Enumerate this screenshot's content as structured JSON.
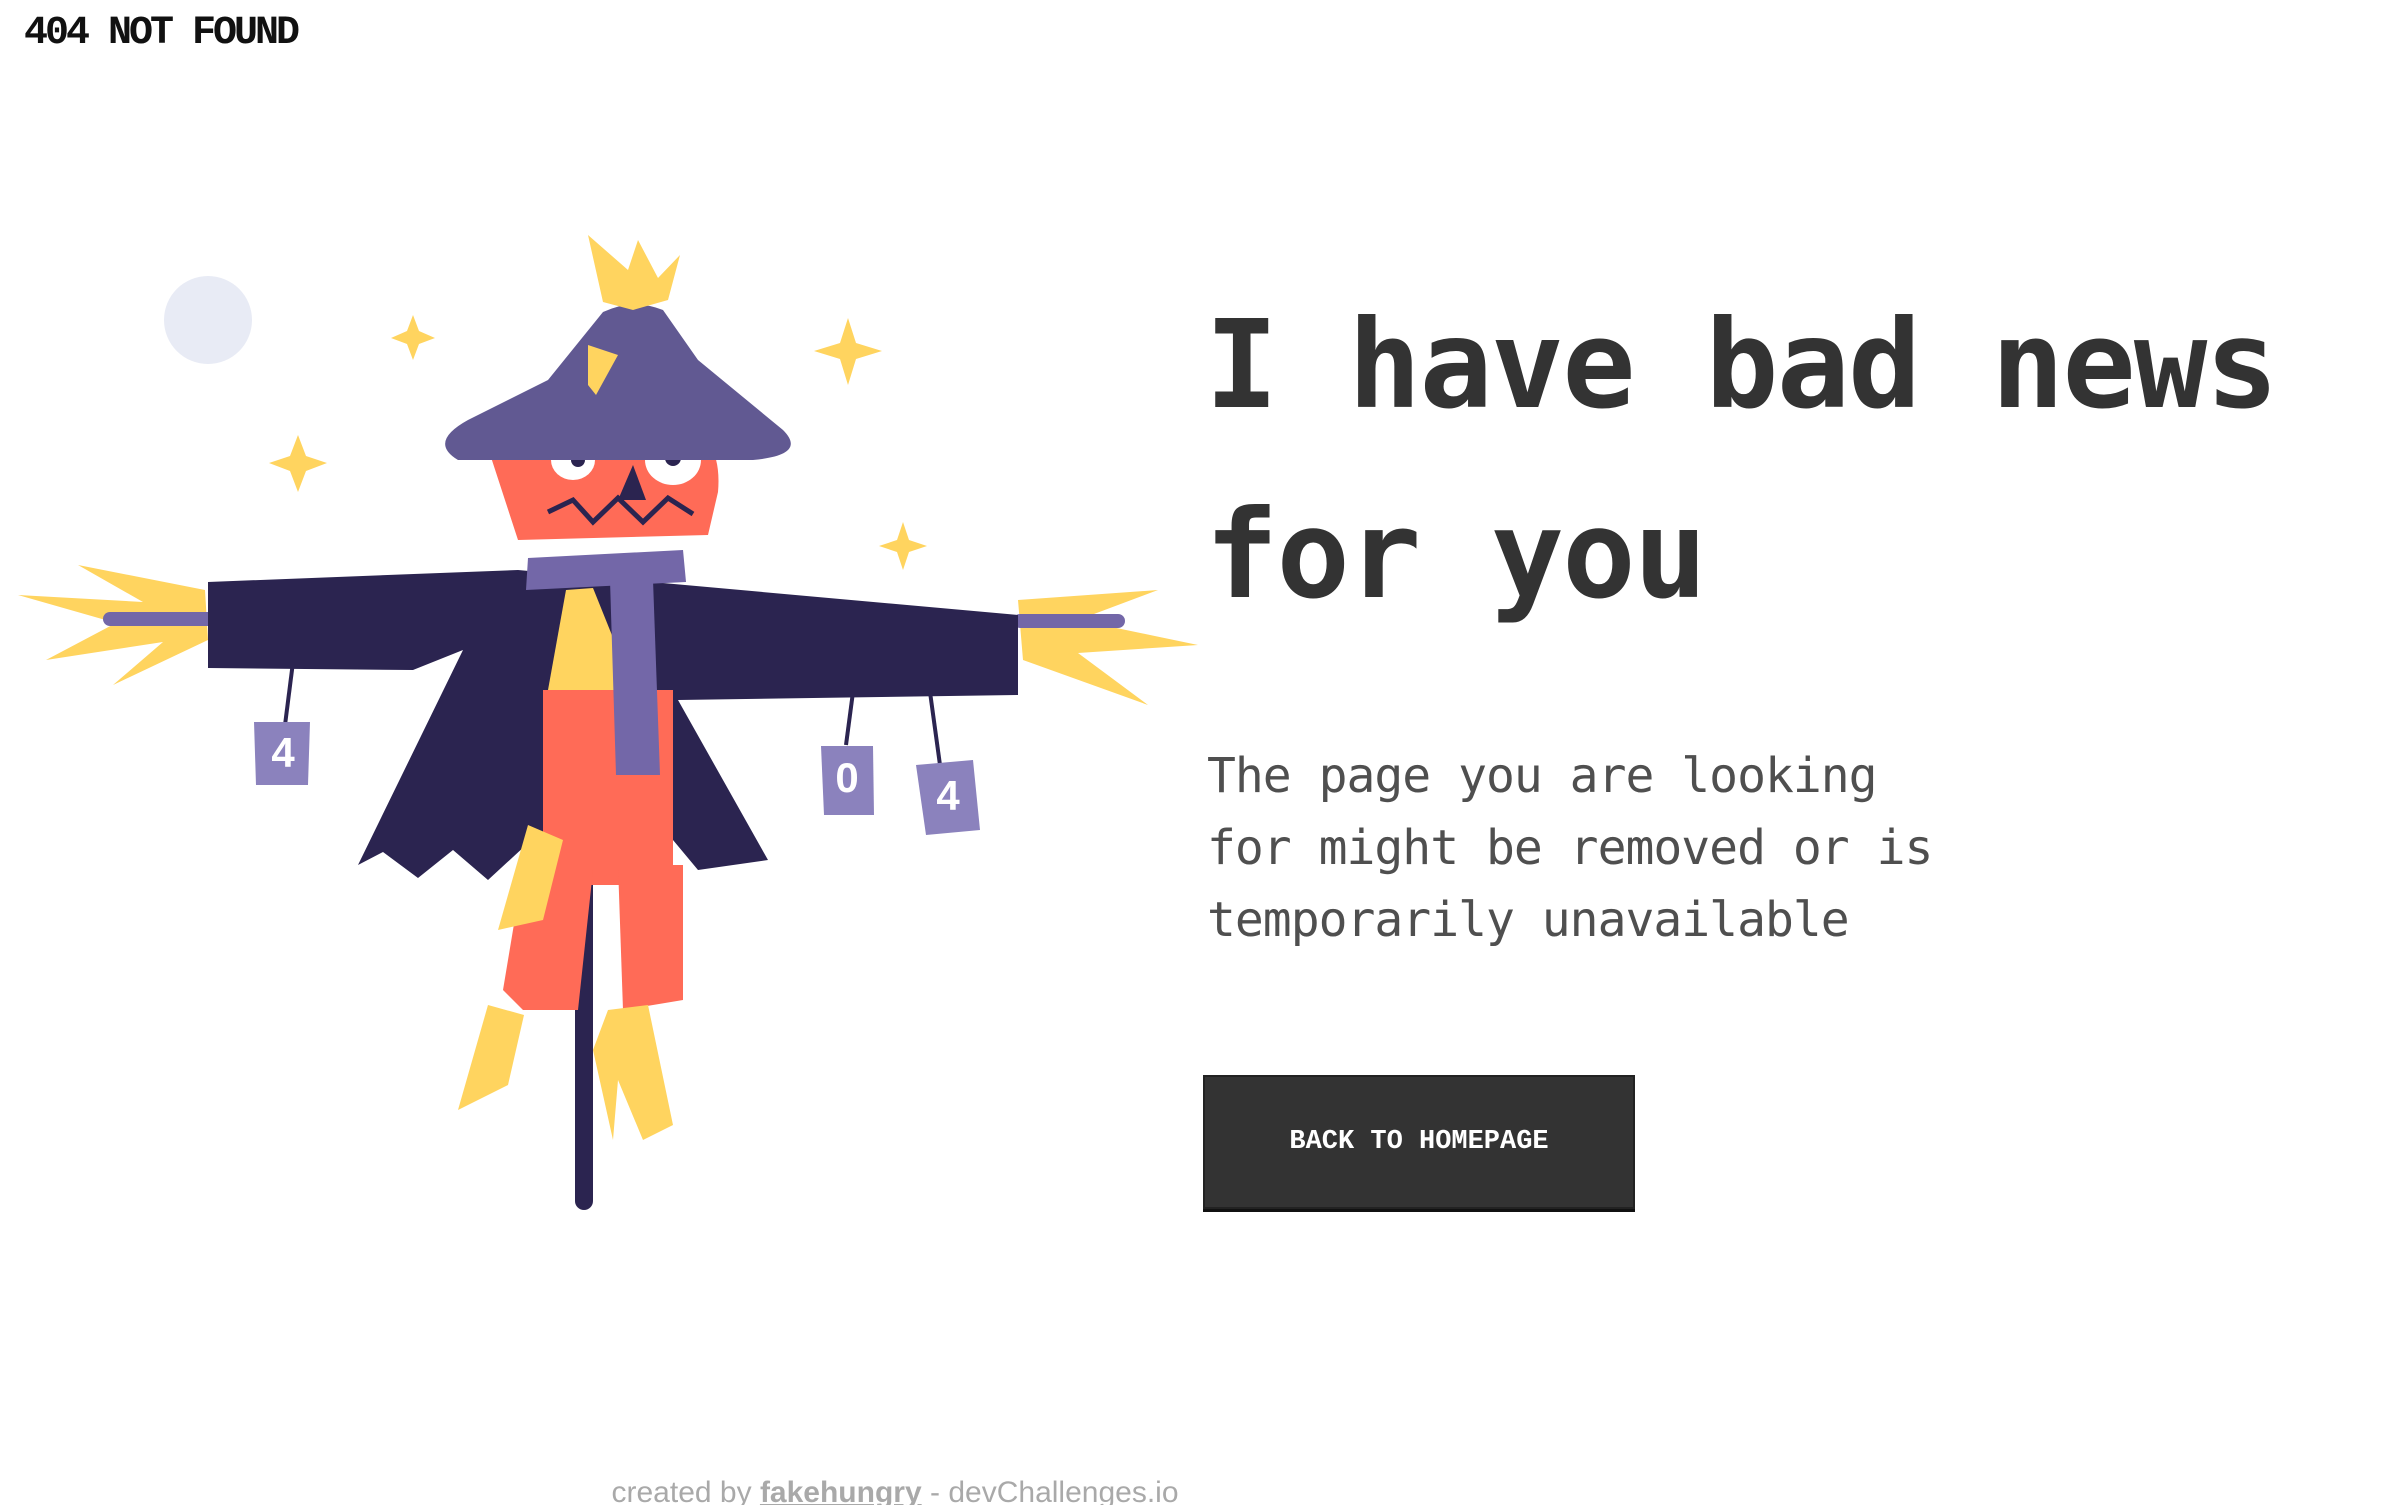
{
  "brand": {
    "title": "404 NOT FOUND"
  },
  "hero": {
    "headline": "I have bad news for you",
    "description": "The page you are looking for might be removed or is temporarily unavailable",
    "button_label": "BACK TO HOMEPAGE"
  },
  "illustration": {
    "can_labels": [
      "4",
      "0",
      "4"
    ],
    "icons": [
      "moon-icon",
      "sparkle-icon"
    ]
  },
  "footer": {
    "prefix": "created by",
    "author": "fakehungry",
    "separator": "-",
    "site": "devChallenges.io"
  },
  "colors": {
    "text": "#333333",
    "muted_text": "#4F4F4F",
    "button": "#333333",
    "button_text": "#FFFFFF",
    "coat": "#2B2450",
    "hat": "#615992",
    "scarf": "#7367A8",
    "orange": "#FF6B57",
    "straw": "#FFD45F",
    "moon": "#E8EBF5",
    "footer": "#A9A9A9"
  }
}
